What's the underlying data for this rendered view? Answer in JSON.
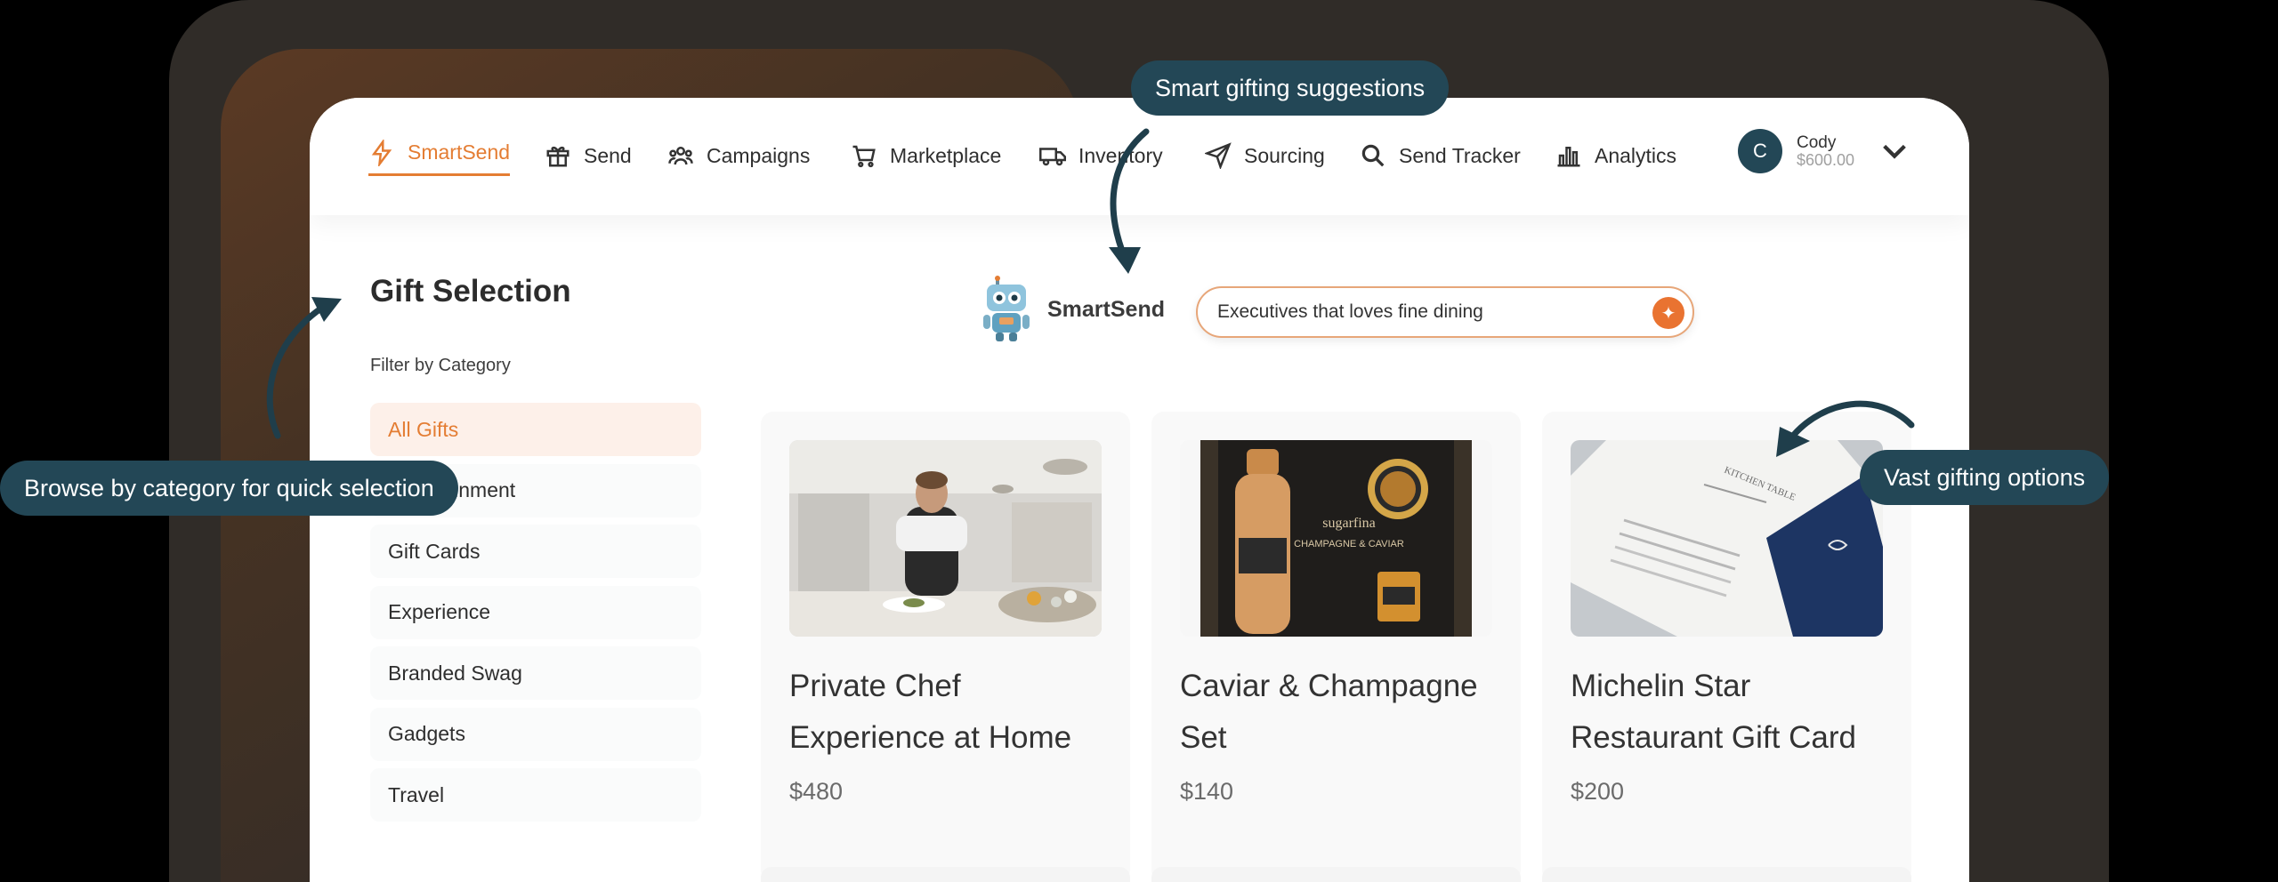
{
  "nav": {
    "items": [
      {
        "label": "SmartSend",
        "icon": "lightning-icon",
        "active": true
      },
      {
        "label": "Send",
        "icon": "gift-icon"
      },
      {
        "label": "Campaigns",
        "icon": "people-icon"
      },
      {
        "label": "Marketplace",
        "icon": "cart-icon"
      },
      {
        "label": "Inventory",
        "icon": "truck-icon"
      },
      {
        "label": "Sourcing",
        "icon": "send-icon"
      },
      {
        "label": "Send Tracker",
        "icon": "search-icon"
      },
      {
        "label": "Analytics",
        "icon": "bar-chart-icon"
      }
    ],
    "user": {
      "initial": "C",
      "name": "Cody",
      "balance": "$600.00"
    }
  },
  "sidebar": {
    "title": "Gift Selection",
    "filter_label": "Filter by Category",
    "categories": [
      "All Gifts",
      "Entertainment",
      "Gift Cards",
      "Experience",
      "Branded Swag",
      "Gadgets",
      "Travel"
    ]
  },
  "smartsend": {
    "brand": "SmartSend",
    "prompt_value": "Executives that loves fine dining"
  },
  "products": [
    {
      "title": "Private Chef Experience at Home",
      "price": "$480"
    },
    {
      "title": "Caviar & Champagne Set",
      "price": "$140"
    },
    {
      "title": "Michelin Star Restaurant Gift Card",
      "price": "$200"
    }
  ],
  "callouts": {
    "suggestions": "Smart gifting suggestions",
    "category": "Browse by category for quick selection",
    "options": "Vast gifting options"
  },
  "product_image_text": {
    "caviar_brand": "sugarfina",
    "caviar_label": "CHAMPAGNE & CAVIAR",
    "menu_heading": "KITCHEN TABLE"
  },
  "colors": {
    "accent": "#e47d33",
    "callout": "#234756",
    "active_bg": "#fdf0e9"
  }
}
